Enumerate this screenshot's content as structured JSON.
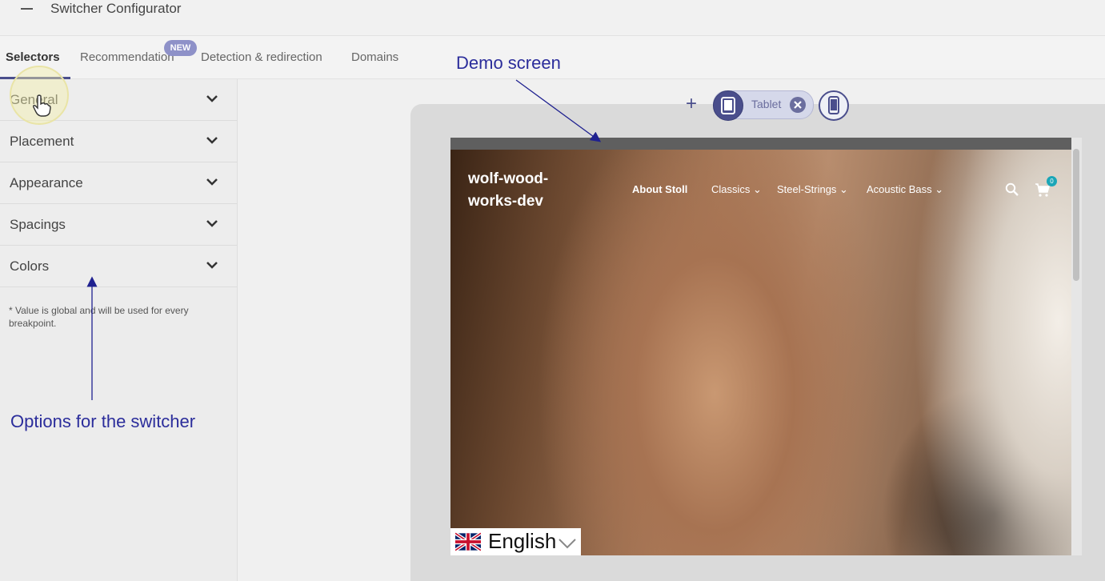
{
  "header": {
    "title": "Switcher Configurator"
  },
  "tabs": [
    {
      "label": "Selectors"
    },
    {
      "label": "Recommendation"
    },
    {
      "label": "Detection & redirection"
    },
    {
      "label": "Domains"
    }
  ],
  "new_badge": "NEW",
  "sidebar": {
    "items": [
      {
        "label": "General"
      },
      {
        "label": "Placement"
      },
      {
        "label": "Appearance"
      },
      {
        "label": "Spacings"
      },
      {
        "label": "Colors"
      }
    ],
    "note": "* Value is global and will be used for every breakpoint."
  },
  "annotations": {
    "demo": "Demo screen",
    "options": "Options for the switcher"
  },
  "devices": {
    "selected_label": "Tablet"
  },
  "site": {
    "logo": "wolf-wood-works-dev",
    "nav": [
      "About Stoll",
      "Classics ⌄",
      "Steel-Strings ⌄",
      "Acoustic Bass ⌄"
    ],
    "cart_count": "0",
    "language": "English"
  },
  "colors": {
    "accent": "#4a4e8c",
    "annotation": "#2b2d9b",
    "badge": "#8e91c8"
  }
}
